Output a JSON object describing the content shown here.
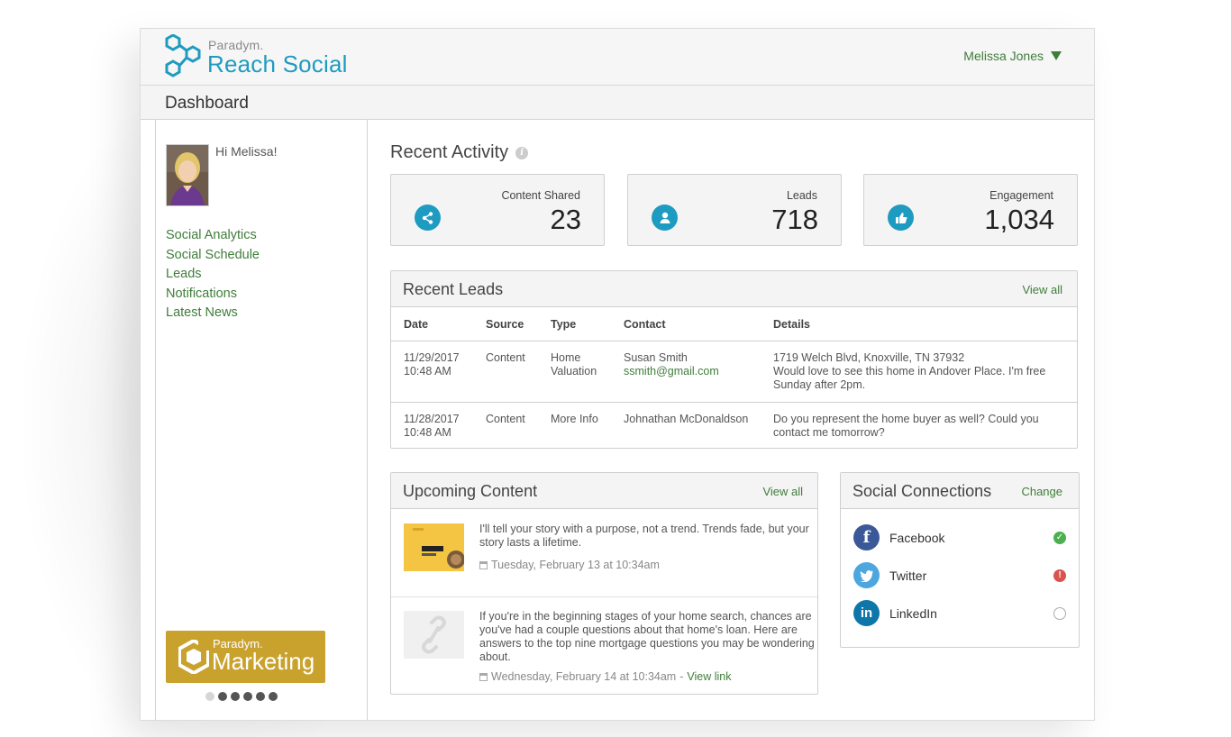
{
  "app": {
    "logo_small": "Paradym.",
    "logo_large": "Reach Social",
    "user_name": "Melissa Jones",
    "page_title": "Dashboard"
  },
  "sidebar": {
    "greeting": "Hi Melissa!",
    "nav": [
      "Social Analytics",
      "Social Schedule",
      "Leads",
      "Notifications",
      "Latest News"
    ],
    "promo_small": "Paradym.",
    "promo_large": "Marketing",
    "carousel_dots": 6,
    "carousel_active": 0
  },
  "recent_activity": {
    "title": "Recent Activity",
    "stats": [
      {
        "label": "Content Shared",
        "value": "23",
        "icon": "share-icon"
      },
      {
        "label": "Leads",
        "value": "718",
        "icon": "person-icon"
      },
      {
        "label": "Engagement",
        "value": "1,034",
        "icon": "thumbs-up-icon"
      }
    ]
  },
  "recent_leads": {
    "title": "Recent Leads",
    "view_all": "View all",
    "columns": [
      "Date",
      "Source",
      "Type",
      "Contact",
      "Details"
    ],
    "rows": [
      {
        "date": "11/29/2017",
        "time": "10:48 AM",
        "source": "Content",
        "type_line1": "Home",
        "type_line2": "Valuation",
        "contact": "Susan Smith",
        "email": "ssmith@gmail.com",
        "details_line1": "1719 Welch Blvd, Knoxville, TN 37932",
        "details_line2": "Would love to see this home in Andover Place. I'm free Sunday after 2pm."
      },
      {
        "date": "11/28/2017",
        "time": "10:48 AM",
        "source": "Content",
        "type_line1": "More Info",
        "type_line2": "",
        "contact": "Johnathan McDonaldson",
        "email": "",
        "details_line1": "Do you represent the home buyer as well? Could you contact me tomorrow?",
        "details_line2": ""
      }
    ]
  },
  "upcoming_content": {
    "title": "Upcoming Content",
    "view_all": "View all",
    "items": [
      {
        "text": "I'll tell your story with a purpose, not a trend. Trends fade, but your story lasts a lifetime.",
        "date": "Tuesday, February 13 at 10:34am",
        "link": "",
        "thumb_text": "NOT A TREND"
      },
      {
        "text": "If you're in the beginning stages of your home search, chances are you've had a couple questions about that home's loan. Here are answers to the top nine mortgage questions you may be wondering about.",
        "date": "Wednesday, February 14 at 10:34am",
        "date_sep": " - ",
        "link": "View link"
      }
    ]
  },
  "social_connections": {
    "title": "Social Connections",
    "action": "Change",
    "networks": [
      {
        "name": "Facebook",
        "glyph": "f",
        "color": "#3b5998",
        "status": "connected",
        "status_color": "#4caf50"
      },
      {
        "name": "Twitter",
        "glyph": "t",
        "color": "#4da7de",
        "status": "error",
        "status_color": "#d9534f"
      },
      {
        "name": "LinkedIn",
        "glyph": "in",
        "color": "#0e76a8",
        "status": "not-connected",
        "status_color": "#aaaaaa"
      }
    ]
  },
  "colors": {
    "accent_blue": "#1e9bc0",
    "link_green": "#3f7d3a",
    "promo_gold": "#c9a22e"
  }
}
